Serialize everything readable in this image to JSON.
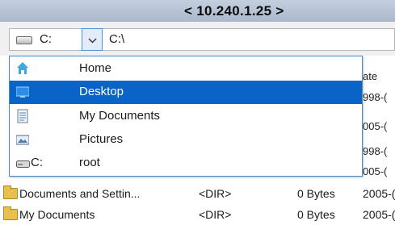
{
  "window": {
    "host": "< 10.240.1.25 >"
  },
  "path_bar": {
    "drive_label": "C:",
    "path_value": "C:\\"
  },
  "dropdown": {
    "items": [
      {
        "label": "Home",
        "icon": "home-icon",
        "selected": false
      },
      {
        "label": "Desktop",
        "icon": "desktop-icon",
        "selected": true
      },
      {
        "label": "My Documents",
        "icon": "documents-icon",
        "selected": false
      },
      {
        "label": "Pictures",
        "icon": "pictures-icon",
        "selected": false
      },
      {
        "drive": "C:",
        "label": "root",
        "icon": "drive-icon",
        "selected": false
      }
    ]
  },
  "file_list": {
    "date_fragments": [
      "ate",
      "998-(",
      "005-(",
      "998-(",
      "005-("
    ],
    "rows": [
      {
        "name": "Documents and Settin...",
        "type": "<DIR>",
        "size": "0 Bytes",
        "date": "2005-("
      },
      {
        "name": "My Documents",
        "type": "<DIR>",
        "size": "0 Bytes",
        "date": "2005-("
      }
    ]
  },
  "colors": {
    "selection": "#0a64c8",
    "accent_border": "#4d87c7",
    "hostbar": "#b6c3d6"
  }
}
